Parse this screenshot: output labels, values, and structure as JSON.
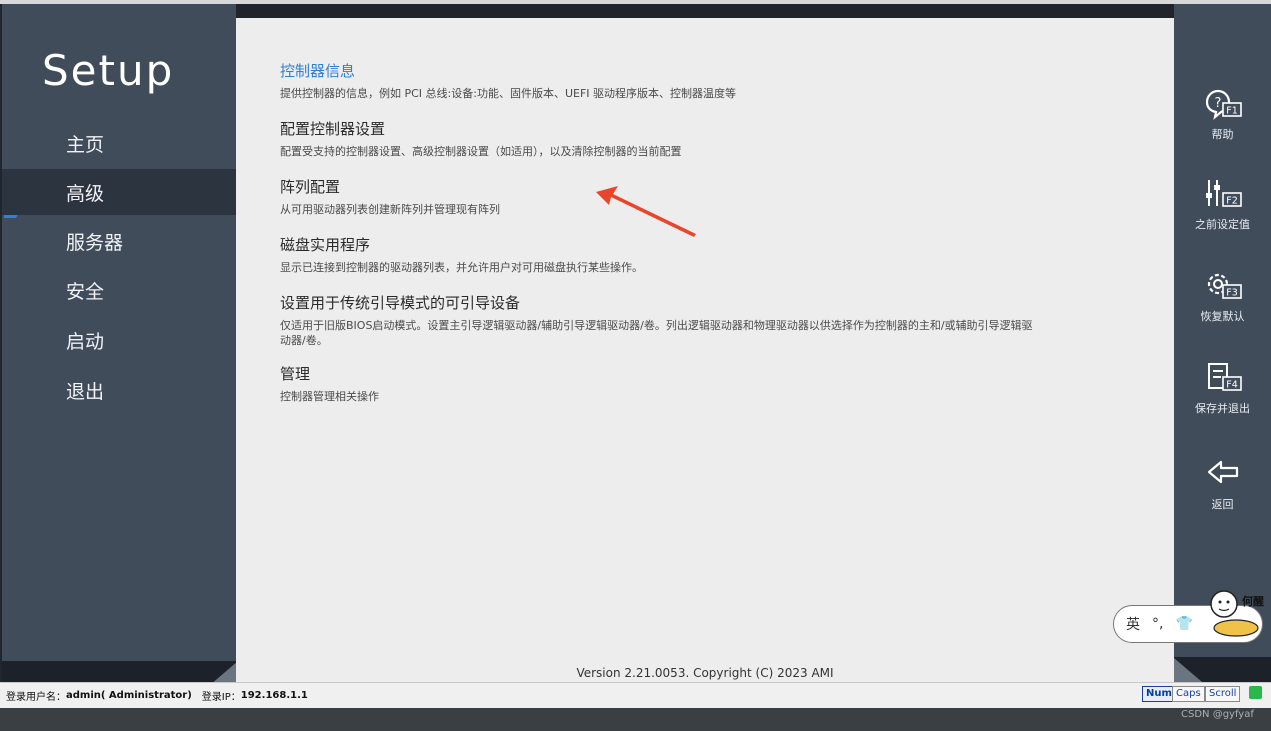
{
  "sidebar": {
    "logo": "Setup",
    "items": [
      {
        "label": "主页"
      },
      {
        "label": "高级"
      },
      {
        "label": "服务器"
      },
      {
        "label": "安全"
      },
      {
        "label": "启动"
      },
      {
        "label": "退出"
      }
    ],
    "active_item": "高级"
  },
  "main": {
    "entries": [
      {
        "title": "控制器信息",
        "desc": "提供控制器的信息，例如 PCI 总线:设备:功能、固件版本、UEFI 驱动程序版本、控制器温度等"
      },
      {
        "title": "配置控制器设置",
        "desc": "配置受支持的控制器设置、高级控制器设置（如适用），以及清除控制器的当前配置"
      },
      {
        "title": "阵列配置",
        "desc": "从可用驱动器列表创建新阵列并管理现有阵列"
      },
      {
        "title": "磁盘实用程序",
        "desc": "显示已连接到控制器的驱动器列表，并允许用户对可用磁盘执行某些操作。"
      },
      {
        "title": "设置用于传统引导模式的可引导设备",
        "desc": "仅适用于旧版BIOS启动模式。设置主引导逻辑驱动器/辅助引导逻辑驱动器/卷。列出逻辑驱动器和物理驱动器以供选择作为控制器的主和/或辅助引导逻辑驱动器/卷。"
      },
      {
        "title": "管理",
        "desc": "控制器管理相关操作"
      }
    ],
    "version": "Version 2.21.0053. Copyright (C) 2023 AMI"
  },
  "rightbar": {
    "buttons": [
      {
        "label": "帮助",
        "key": "F1",
        "icon": "help-icon"
      },
      {
        "label": "之前设定值",
        "key": "F2",
        "icon": "sliders-icon"
      },
      {
        "label": "恢复默认",
        "key": "F3",
        "icon": "gear-icon"
      },
      {
        "label": "保存并退出",
        "key": "F4",
        "icon": "save-exit-icon"
      },
      {
        "label": "返回",
        "icon": "back-arrow-icon"
      }
    ]
  },
  "ime": {
    "lang": "英",
    "punct": "°,",
    "skin": "👕"
  },
  "mascot": {
    "text": "何醒"
  },
  "statusbar": {
    "user_label": "登录用户名：",
    "user_value": "admin( Administrator)",
    "ip_label": "登录IP：",
    "ip_value": "192.168.1.1",
    "num": "Num",
    "caps": "Caps",
    "scroll": "Scroll"
  },
  "watermark": "CSDN @gyfyaf",
  "colors": {
    "sidebar_bg": "#414c5b",
    "active_bg": "#2c3440",
    "link": "#2e7fd6",
    "arrow": "#e8452a",
    "marker": "#2f7fe0"
  }
}
